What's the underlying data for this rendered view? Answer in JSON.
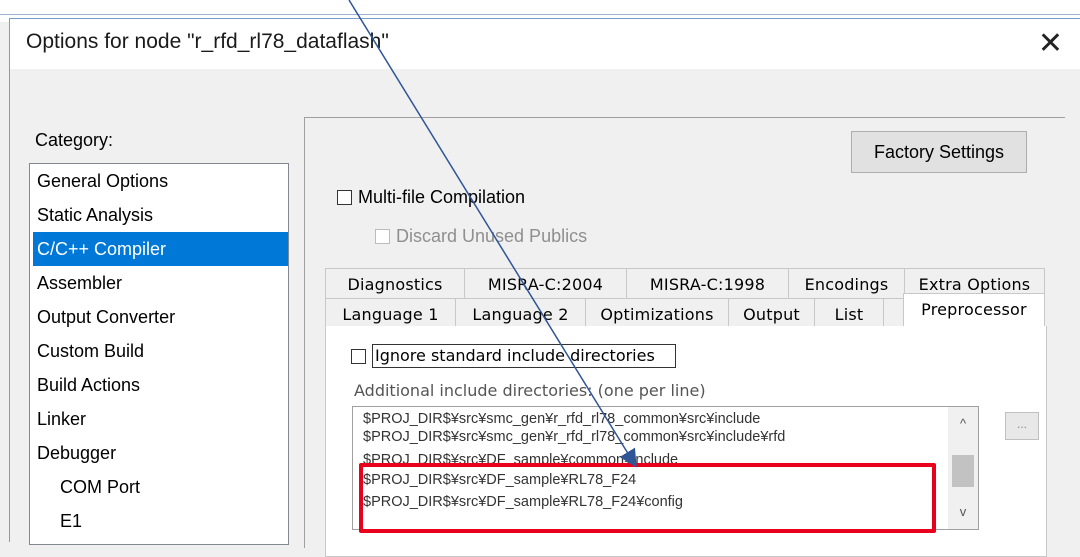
{
  "window": {
    "title": "Options for node \"r_rfd_rl78_dataflash\"",
    "close_glyph": "✕"
  },
  "category": {
    "label": "Category:",
    "items": [
      {
        "label": "General Options"
      },
      {
        "label": "Static Analysis"
      },
      {
        "label": "C/C++ Compiler",
        "selected": true
      },
      {
        "label": "Assembler"
      },
      {
        "label": "Output Converter"
      },
      {
        "label": "Custom Build"
      },
      {
        "label": "Build Actions"
      },
      {
        "label": "Linker"
      },
      {
        "label": "Debugger"
      },
      {
        "label": "COM Port",
        "sub": true
      },
      {
        "label": "E1",
        "sub": true
      }
    ]
  },
  "panel": {
    "factory_settings": "Factory Settings",
    "multi_file": "Multi-file Compilation",
    "discard_unused": "Discard Unused Publics"
  },
  "tabs": {
    "row1": [
      "Diagnostics",
      "MISRA-C:2004",
      "MISRA-C:1998",
      "Encodings",
      "Extra Options"
    ],
    "row2": [
      "Language 1",
      "Language 2",
      "Optimizations",
      "Output",
      "List",
      "Preprocessor"
    ],
    "active": "Preprocessor"
  },
  "preprocessor": {
    "ignore_std": "Ignore standard include directories",
    "additional_label": "Additional include directories: (one per line)",
    "dirs": [
      "$PROJ_DIR$¥src¥smc_gen¥r_rfd_rl78_common¥src¥include",
      "$PROJ_DIR$¥src¥smc_gen¥r_rfd_rl78_common¥src¥include¥rfd",
      "$PROJ_DIR$¥src¥DF_sample¥common¥include",
      "$PROJ_DIR$¥src¥DF_sample¥RL78_F24",
      "$PROJ_DIR$¥src¥DF_sample¥RL78_F24¥config"
    ],
    "browse": "...",
    "scroll_up": "^",
    "scroll_down": "v"
  },
  "colors": {
    "selection": "#0078d7",
    "highlight": "#e8001c",
    "arrow": "#2f5597"
  }
}
